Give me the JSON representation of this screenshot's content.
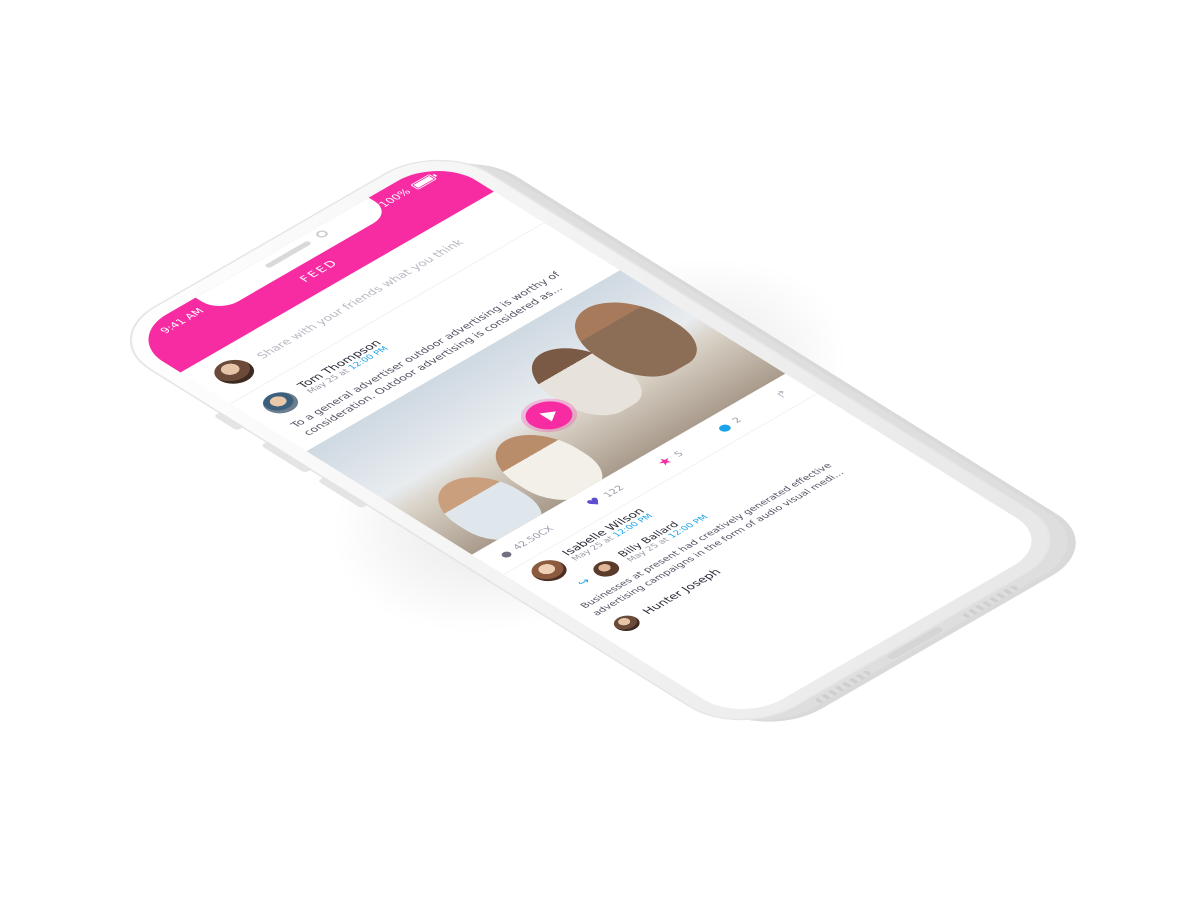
{
  "status_bar": {
    "time": "9:41 AM",
    "battery": "100%"
  },
  "nav": {
    "title": "FEED"
  },
  "composer": {
    "placeholder": "Share with your friends what you think"
  },
  "post": {
    "author": "Tom Thompson",
    "date_prefix": "May 25 at",
    "time": "12:00 PM",
    "text": "To a general advertiser outdoor advertising is worthy of consideration. Outdoor advertising is considered as..."
  },
  "actions": {
    "views": "42.50CX",
    "likes": "122",
    "stars": "5",
    "comments": "2"
  },
  "comments": [
    {
      "author": "Isabelle Wilson",
      "date_prefix": "May 25 at",
      "time": "12:00 PM"
    }
  ],
  "reply": {
    "author": "Billy Ballard",
    "date_prefix": "May 25 at",
    "time": "12:00 PM",
    "text": "Businesses at present had creatively generated effective advertising campaigns in the form of audio visual medi..."
  },
  "next_author": "Hunter Joseph",
  "colors": {
    "accent": "#f72ca3",
    "link": "#1aa3e8",
    "like": "#5b4fcf"
  }
}
